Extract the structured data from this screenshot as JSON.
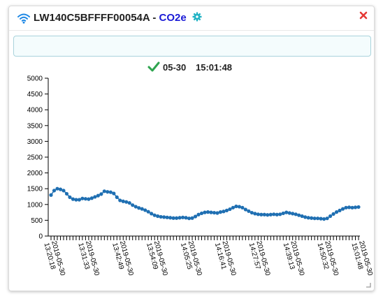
{
  "widget": {
    "device_id": "LW140C5BFFFF00054A",
    "separator": " - ",
    "metric": "CO2e",
    "input_value": ""
  },
  "status": {
    "date": "05-30",
    "time": "15:01:48"
  },
  "icons": {
    "wifi": "wifi-icon",
    "gear": "gear-icon",
    "close": "close-icon",
    "status": "check-icon",
    "resize": "resize-handle-icon"
  },
  "colors": {
    "wifi": "#1e88e5",
    "metric": "#1a1ad6",
    "gear": "#20b2c4",
    "close": "#e53935",
    "check": "#2ea44f",
    "series": "#1f6fb2"
  },
  "chart_data": {
    "type": "line",
    "title": "",
    "xlabel": "",
    "ylabel": "",
    "ylim": [
      0,
      5000
    ],
    "yticks": [
      0,
      500,
      1000,
      1500,
      2000,
      2500,
      3000,
      3500,
      4000,
      4500,
      5000
    ],
    "xtick_labels": [
      {
        "date": "2019-05-30",
        "time": "13:20:18"
      },
      {
        "date": "2019-05-30",
        "time": "13:31:33"
      },
      {
        "date": "2019-05-30",
        "time": "13:42:49"
      },
      {
        "date": "2019-05-30",
        "time": "13:54:09"
      },
      {
        "date": "2019-05-30",
        "time": "14:05:25"
      },
      {
        "date": "2019-05-30",
        "time": "14:16:41"
      },
      {
        "date": "2019-05-30",
        "time": "14:27:57"
      },
      {
        "date": "2019-05-30",
        "time": "14:39:13"
      },
      {
        "date": "2019-05-30",
        "time": "14:50:32"
      },
      {
        "date": "2019-05-30",
        "time": "15:01:48"
      }
    ],
    "series": [
      {
        "values": [
          1300,
          1440,
          1500,
          1480,
          1440,
          1340,
          1230,
          1170,
          1150,
          1150,
          1190,
          1180,
          1170,
          1200,
          1240,
          1280,
          1330,
          1420,
          1400,
          1390,
          1350,
          1230,
          1130,
          1100,
          1080,
          1050,
          980,
          930,
          890,
          860,
          820,
          770,
          710,
          660,
          630,
          610,
          600,
          590,
          580,
          570,
          570,
          580,
          590,
          580,
          560,
          570,
          620,
          680,
          720,
          750,
          760,
          750,
          740,
          730,
          760,
          780,
          810,
          850,
          900,
          940,
          930,
          900,
          840,
          790,
          740,
          710,
          690,
          680,
          680,
          670,
          680,
          690,
          680,
          690,
          720,
          750,
          730,
          710,
          690,
          660,
          630,
          600,
          580,
          570,
          560,
          560,
          550,
          540,
          560,
          630,
          700,
          760,
          810,
          860,
          900,
          910,
          900,
          910,
          920
        ]
      }
    ]
  }
}
